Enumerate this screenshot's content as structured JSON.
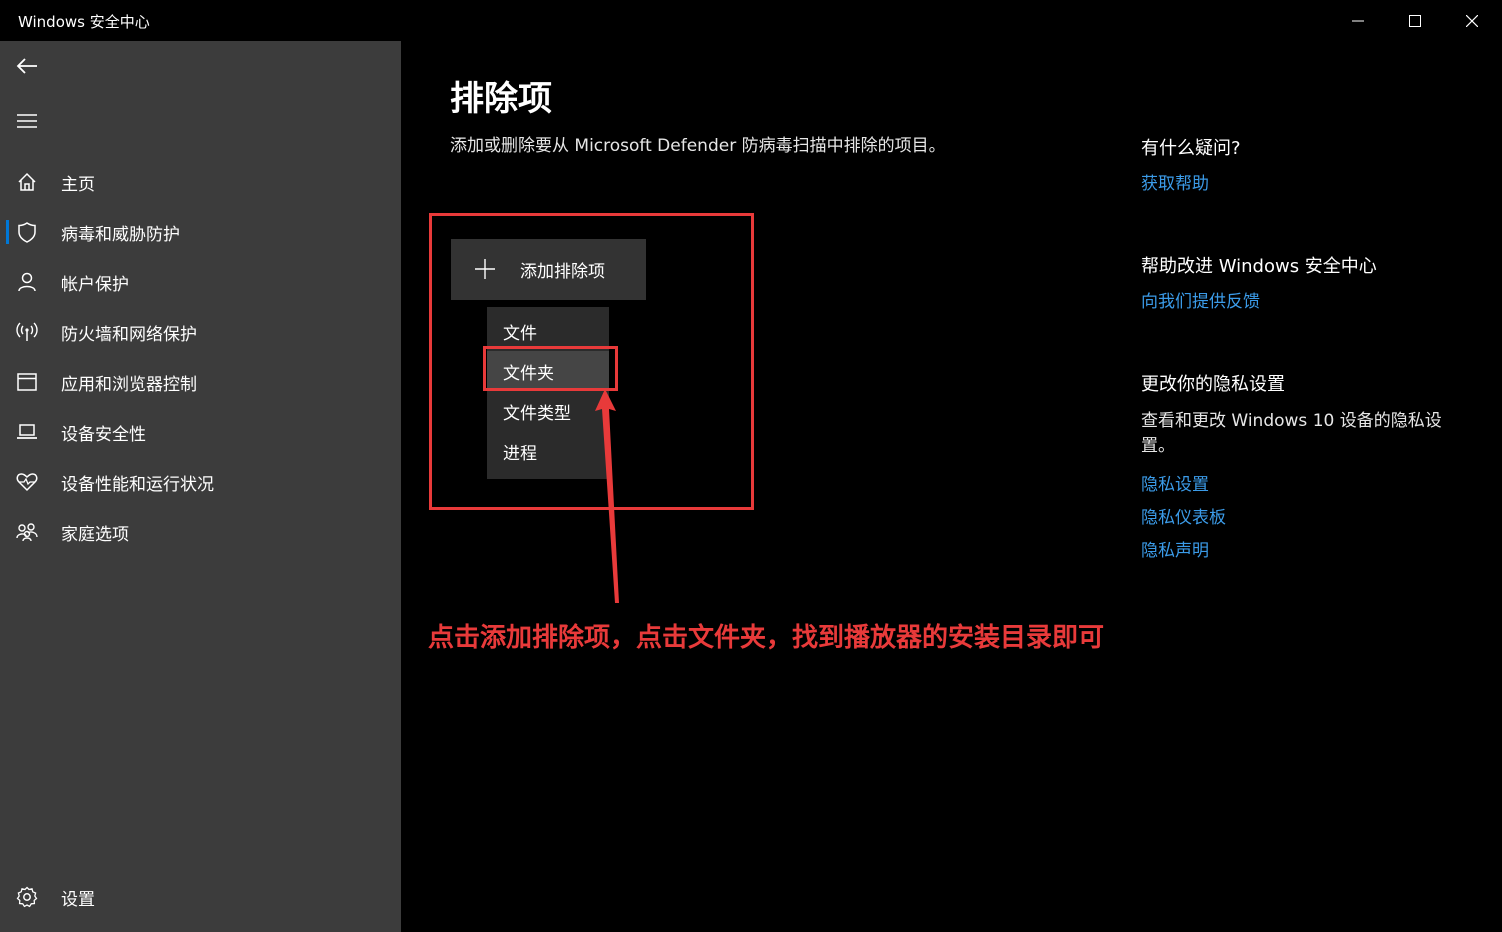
{
  "window": {
    "title": "Windows 安全中心"
  },
  "sidebar": {
    "items": [
      {
        "label": "主页",
        "icon": "home-icon"
      },
      {
        "label": "病毒和威胁防护",
        "icon": "shield-icon",
        "active": true
      },
      {
        "label": "帐户保护",
        "icon": "person-icon"
      },
      {
        "label": "防火墙和网络保护",
        "icon": "wifi-antenna-icon"
      },
      {
        "label": "应用和浏览器控制",
        "icon": "browser-window-icon"
      },
      {
        "label": "设备安全性",
        "icon": "laptop-icon"
      },
      {
        "label": "设备性能和运行状况",
        "icon": "heart-pulse-icon"
      },
      {
        "label": "家庭选项",
        "icon": "family-icon"
      }
    ],
    "settings_label": "设置"
  },
  "main": {
    "title": "排除项",
    "description": "添加或删除要从 Microsoft Defender 防病毒扫描中排除的项目。",
    "add_button_label": "添加排除项",
    "dropdown": [
      {
        "label": "文件"
      },
      {
        "label": "文件夹",
        "highlighted": true
      },
      {
        "label": "文件类型"
      },
      {
        "label": "进程"
      }
    ],
    "annotation": "点击添加排除项，点击文件夹，找到播放器的安装目录即可"
  },
  "right_panel": {
    "question_heading": "有什么疑问?",
    "help_link": "获取帮助",
    "improve_heading": "帮助改进 Windows 安全中心",
    "feedback_link": "向我们提供反馈",
    "privacy_heading": "更改你的隐私设置",
    "privacy_text": "查看和更改 Windows 10 设备的隐私设置。",
    "privacy_links": [
      "隐私设置",
      "隐私仪表板",
      "隐私声明"
    ]
  },
  "colors": {
    "accent": "#0078d7",
    "link": "#3b9be8",
    "annotation_red": "#e83a3a",
    "sidebar_bg": "#3c3c3c"
  }
}
